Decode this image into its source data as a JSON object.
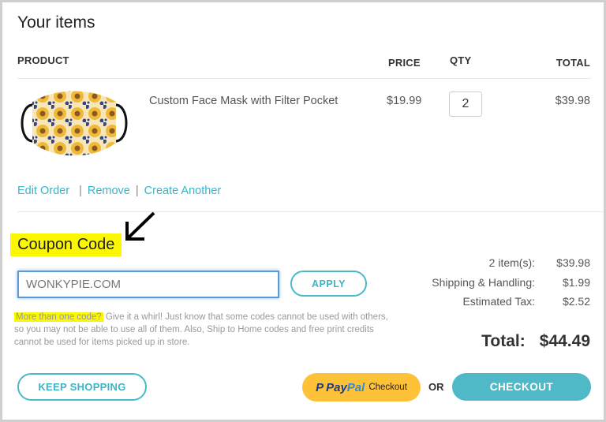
{
  "cart": {
    "title": "Your items",
    "columns": {
      "product": "PRODUCT",
      "price": "PRICE",
      "qty": "QTY",
      "total": "TOTAL"
    },
    "items": [
      {
        "image": "sunflower-face-mask-image",
        "name": "Custom Face Mask with Filter Pocket",
        "price": "$19.99",
        "qty": "2",
        "total": "$39.98"
      }
    ],
    "item_actions": {
      "edit": "Edit Order",
      "remove": "Remove",
      "create": "Create Another",
      "separator": "|"
    }
  },
  "coupon": {
    "title": "Coupon Code",
    "input_value": "WONKYPIE.COM",
    "apply_label": "APPLY",
    "note_highlight": "More than one code?",
    "note_text": " Give it a whirl! Just know that some codes cannot be used with others, so you may not be able to use all of them. Also, Ship to Home codes and free print credits cannot be used for items picked up in store."
  },
  "summary": {
    "rows": [
      {
        "label": "2 item(s):",
        "value": "$39.98"
      },
      {
        "label": "Shipping & Handling:",
        "value": "$1.99"
      },
      {
        "label": "Estimated Tax:",
        "value": "$2.52"
      }
    ],
    "total_label": "Total:",
    "total_value": "$44.49"
  },
  "actions": {
    "keep_shopping": "KEEP SHOPPING",
    "paypal_pay": "Pay",
    "paypal_pal": "Pal",
    "paypal_checkout": "Checkout",
    "or": "OR",
    "checkout": "CHECKOUT"
  },
  "colors": {
    "accent": "#4fb9c8",
    "paypal_yellow": "#fec238",
    "highlight": "#fbf700",
    "focus_blue": "#5a9bd8"
  }
}
